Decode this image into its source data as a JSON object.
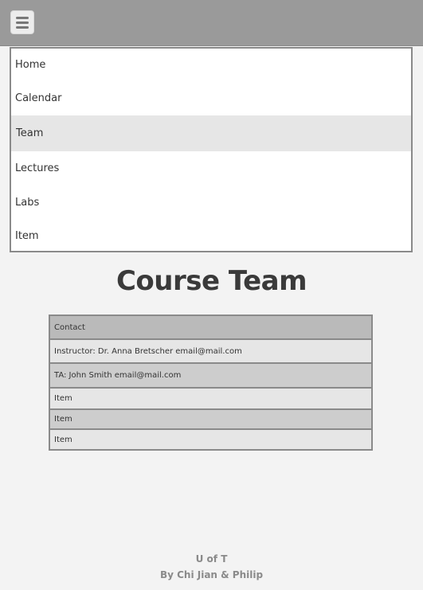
{
  "header": {
    "menu_icon": "hamburger-menu-icon"
  },
  "nav": {
    "items": [
      {
        "label": "Home"
      },
      {
        "label": "Calendar"
      },
      {
        "label": "Team"
      },
      {
        "label": "Lectures"
      },
      {
        "label": "Labs"
      },
      {
        "label": "Item"
      }
    ],
    "active": "Team"
  },
  "main": {
    "title": "Course Team",
    "table": {
      "header": "Contact",
      "rows": [
        "Instructor: Dr. Anna Bretscher email@mail.com",
        "TA:  John Smith email@mail.com",
        "Item",
        "Item",
        "Item"
      ]
    }
  },
  "footer": {
    "line1": "U of T",
    "line2": "By Chi Jian & Philip"
  },
  "colors": {
    "topbar": "#9a9a9a",
    "page_bg": "#f3f3f3",
    "active_item": "#e6e6e6",
    "table_header": "#bababa",
    "table_row_light": "#e6e6e6",
    "table_row_dark": "#cdcdcd",
    "border": "#8a8a8a"
  }
}
